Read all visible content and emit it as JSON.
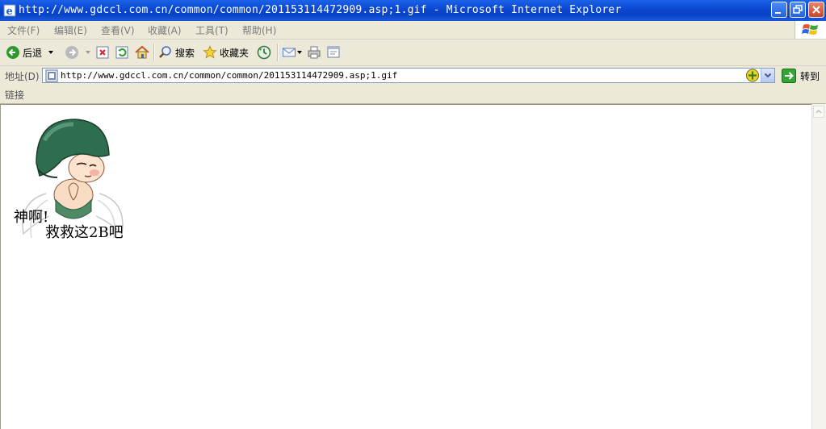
{
  "window": {
    "title": "http://www.gdccl.com.cn/common/common/201153114472909.asp;1.gif - Microsoft Internet Explorer"
  },
  "menu": {
    "items": [
      "文件(F)",
      "编辑(E)",
      "查看(V)",
      "收藏(A)",
      "工具(T)",
      "帮助(H)"
    ]
  },
  "toolbar": {
    "back_label": "后退",
    "search_label": "搜索",
    "favorites_label": "收藏夹"
  },
  "address": {
    "label": "地址(D)",
    "url": "http://www.gdccl.com.cn/common/common/201153114472909.asp;1.gif",
    "go_label": "转到"
  },
  "links": {
    "label": "链接"
  },
  "content": {
    "caption_line1": "神啊!",
    "caption_line2": "救救这2B吧"
  },
  "colors": {
    "titlebar": "#0a47d2",
    "chrome": "#ece9d8",
    "helmet": "#2e6e4e"
  }
}
